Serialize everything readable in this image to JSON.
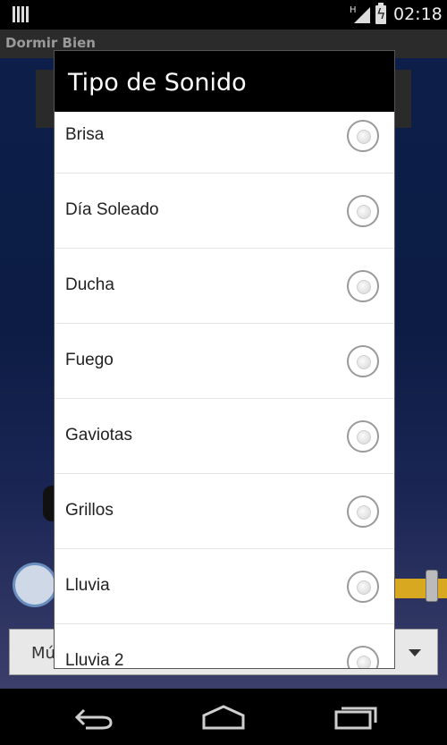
{
  "status_bar": {
    "time": "02:18",
    "network_type": "H",
    "icons": [
      "sim-card-icon",
      "signal-icon",
      "battery-charging-icon"
    ]
  },
  "app": {
    "title": "Dormir Bien",
    "selector_text": "Mú"
  },
  "dialog": {
    "title": "Tipo de Sonido",
    "items": [
      {
        "label": "Brisa",
        "selected": false
      },
      {
        "label": "Día Soleado",
        "selected": false
      },
      {
        "label": "Ducha",
        "selected": false
      },
      {
        "label": "Fuego",
        "selected": false
      },
      {
        "label": "Gaviotas",
        "selected": false
      },
      {
        "label": "Grillos",
        "selected": false
      },
      {
        "label": "Lluvia",
        "selected": false
      },
      {
        "label": "Lluvia 2",
        "selected": false
      }
    ]
  },
  "nav_bar": {
    "icons": [
      "back-icon",
      "home-icon",
      "recent-apps-icon"
    ]
  },
  "colors": {
    "accent_slider": "#d8a820",
    "dialog_header": "#000000"
  }
}
